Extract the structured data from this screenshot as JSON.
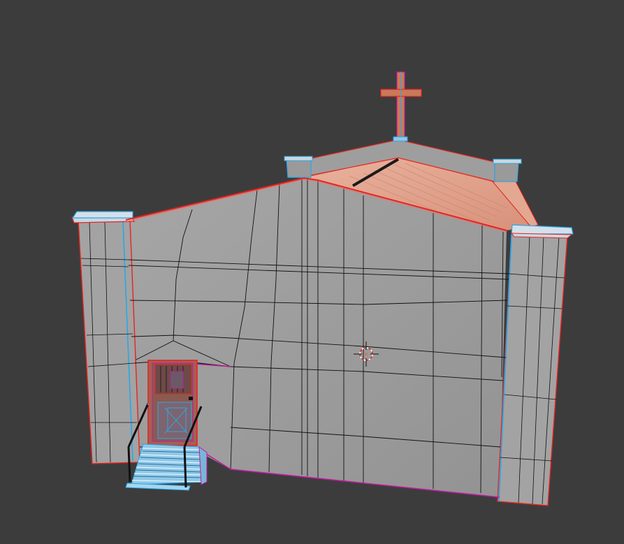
{
  "viewport": {
    "background": "#3c3c3c",
    "wire_color": "#111111",
    "selected_edge_color": "#e8231f",
    "boundary_edge_color": "#c21aa0",
    "seam_edge_color": "#2aa7e6",
    "wall_fill": "#9c9c9c",
    "roof_fill": "#dfa08a",
    "cross_fill": "#c97a5a",
    "cap_fill": "#c9d7e3",
    "stairs_fill": "#8fc8e8",
    "door_fill": "#8a5a50",
    "cursor_icon": "3d-cursor-crosshair"
  }
}
